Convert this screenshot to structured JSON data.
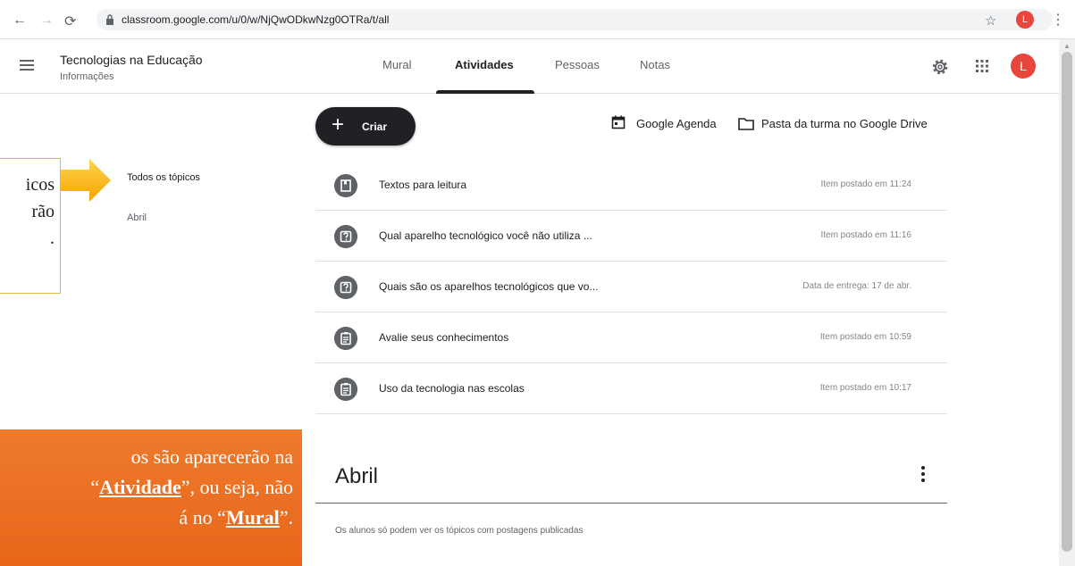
{
  "browser": {
    "url": "classroom.google.com/u/0/w/NjQwODkwNzg0OTRa/t/all",
    "profile_initial": "L"
  },
  "header": {
    "class_title": "Tecnologias na Educação",
    "class_subtitle": "Informações",
    "tabs": [
      {
        "label": "Mural"
      },
      {
        "label": "Atividades"
      },
      {
        "label": "Pessoas"
      },
      {
        "label": "Notas"
      }
    ],
    "avatar_initial": "L"
  },
  "sidebar": {
    "topics": [
      {
        "label": "Todos os tópicos"
      },
      {
        "label": "Abril"
      }
    ]
  },
  "annotations": {
    "yellow_lines": "icos\nrão\n.",
    "orange_pre": "os são aparecerão na ",
    "orange_atividade": "Atividade",
    "orange_mid": "”, ou seja, não ",
    "orange_line3": "á no “",
    "orange_mural": "Mural",
    "orange_end": "”."
  },
  "toolbar": {
    "create_label": "Criar",
    "calendar_label": "Google Agenda",
    "drive_label": "Pasta da turma no Google Drive"
  },
  "items": [
    {
      "icon": "material-icon",
      "title": "Textos para leitura",
      "meta": "Item postado em 11:24"
    },
    {
      "icon": "question-icon",
      "title": "Qual aparelho tecnológico você não utiliza ...",
      "meta": "Item postado em 11:16"
    },
    {
      "icon": "question-icon",
      "title": "Quais são os aparelhos tecnológicos que vo...",
      "meta": "Data de entrega: 17 de abr."
    },
    {
      "icon": "assignment-icon",
      "title": "Avalie seus conhecimentos",
      "meta": "Item postado em 10:59"
    },
    {
      "icon": "assignment-icon",
      "title": "Uso da tecnologia nas escolas",
      "meta": "Item postado em 10:17"
    }
  ],
  "section": {
    "title": "Abril",
    "note": "Os alunos só podem ver os tópicos com postagens publicadas"
  },
  "colors": {
    "accent_dark": "#202124",
    "avatar": "#e8453c",
    "orange_note": "#e8661a",
    "arrow": "#f5b800"
  }
}
